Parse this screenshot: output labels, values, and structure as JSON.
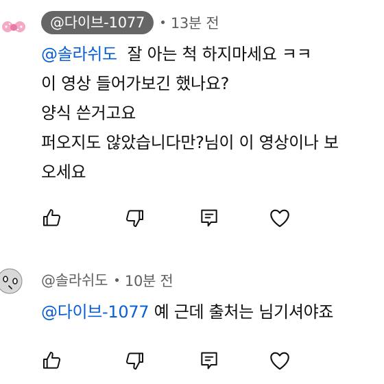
{
  "comments": [
    {
      "handle": "@다이브-1077",
      "separator": "•",
      "time": "13분 전",
      "mention": "@솔라쉬도",
      "lines": [
        "  잘 아는 척 하지마세요 ㅋㅋ",
        "이 영상 들어가보긴 했나요?",
        "양식 쓴거고요",
        "퍼오지도 않았습니다만?님이 이 영상이나 보",
        "오세요"
      ],
      "avatar_icon": "hello-kitty-bow-avatar"
    },
    {
      "handle": "@솔라쉬도",
      "separator": "•",
      "time": "10분 전",
      "mention": "@다이브-1077",
      "lines": [
        " 예 근데 출처는 님기셔야죠"
      ],
      "avatar_icon": "cartoon-face-avatar"
    }
  ],
  "actions": {
    "like_icon": "thumbs-up-icon",
    "dislike_icon": "thumbs-down-icon",
    "reply_icon": "reply-comment-icon",
    "heart_icon": "heart-icon"
  }
}
